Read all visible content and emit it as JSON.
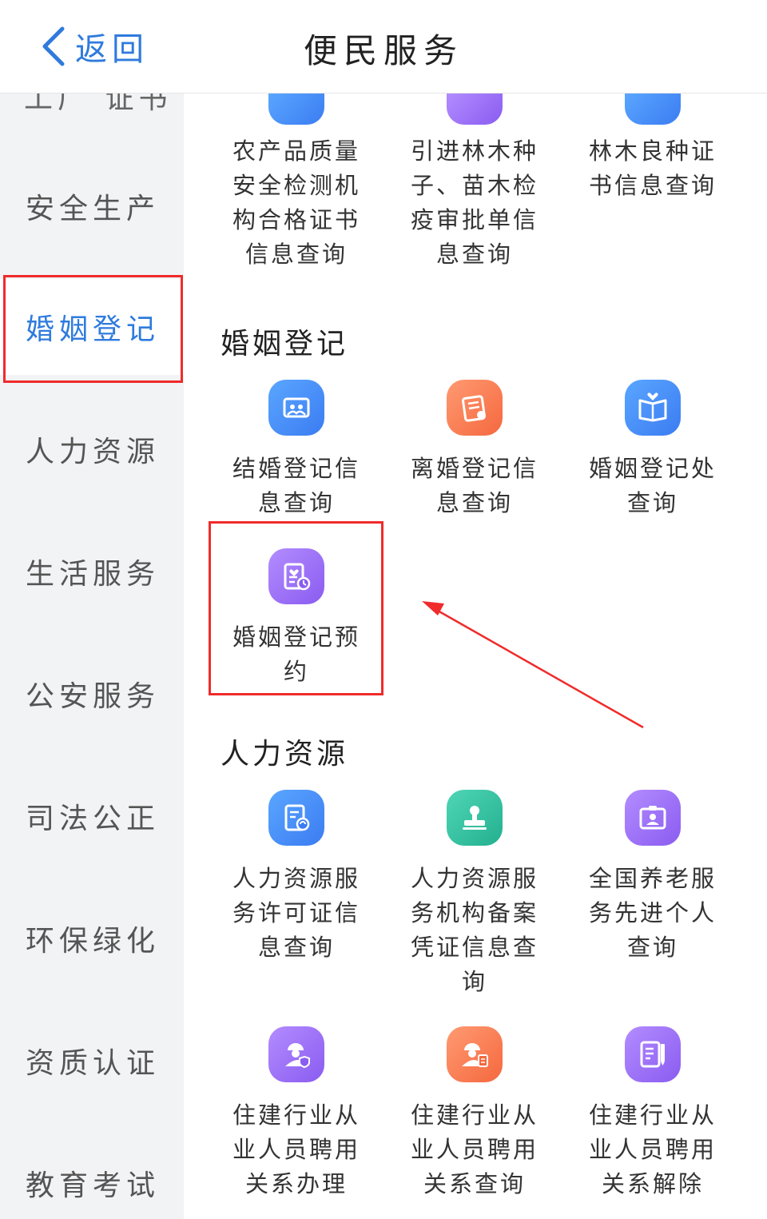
{
  "header": {
    "back_label": "返回",
    "title": "便民服务"
  },
  "sidebar": {
    "clipped_label": "工厂 证书",
    "items": [
      {
        "label": "安全生产"
      },
      {
        "label": "婚姻登记"
      },
      {
        "label": "人力资源"
      },
      {
        "label": "生活服务"
      },
      {
        "label": "公安服务"
      },
      {
        "label": "司法公正"
      },
      {
        "label": "环保绿化"
      },
      {
        "label": "资质认证"
      },
      {
        "label": "教育考试"
      }
    ]
  },
  "sections": {
    "top": {
      "tiles": [
        {
          "label": "农产品质量安全检测机构合格证书信息查询",
          "icon": "document-icon",
          "color": "#3b7cf2"
        },
        {
          "label": "引进林木种子、苗木检疫审批单信息查询",
          "icon": "document-icon",
          "color": "#8a5cf0"
        },
        {
          "label": "林木良种证书信息查询",
          "icon": "document-icon",
          "color": "#3b7cf2"
        }
      ]
    },
    "marriage": {
      "title": "婚姻登记",
      "tiles": [
        {
          "label": "结婚登记信息查询",
          "icon": "wedding-photo-icon"
        },
        {
          "label": "离婚登记信息查询",
          "icon": "certificate-icon"
        },
        {
          "label": "婚姻登记处查询",
          "icon": "couple-book-icon"
        },
        {
          "label": "婚姻登记预约",
          "icon": "appointment-clock-icon"
        }
      ]
    },
    "hr": {
      "title": "人力资源",
      "tiles": [
        {
          "label": "人力资源服务许可证信息查询",
          "icon": "license-refresh-icon"
        },
        {
          "label": "人力资源服务机构备案凭证信息查询",
          "icon": "stamp-icon"
        },
        {
          "label": "全国养老服务先进个人查询",
          "icon": "id-badge-icon"
        },
        {
          "label": "住建行业从业人员聘用关系办理",
          "icon": "worker-shield-icon"
        },
        {
          "label": "住建行业从业人员聘用关系查询",
          "icon": "worker-document-icon"
        },
        {
          "label": "住建行业从业人员聘用关系解除",
          "icon": "notes-pen-icon"
        }
      ]
    }
  },
  "colors": {
    "accent": "#2f7bdd",
    "highlight": "#f02b2b"
  }
}
